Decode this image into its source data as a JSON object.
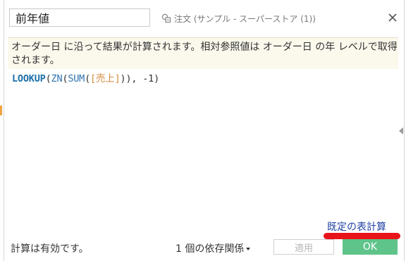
{
  "header": {
    "calc_name": "前年値",
    "datasource_label": "注文 (サンプル - スーパーストア (1))",
    "datasource_icon": "linked-datasource-icon",
    "close_icon": "close-icon"
  },
  "info": {
    "text": "オーダー日 に沿って結果が計算されます。相対参照値は オーダー日 の年 レベルで取得されます。"
  },
  "formula": {
    "func_lookup": "LOOKUP",
    "p1": "(",
    "func_zn": "ZN",
    "p2": "(",
    "func_sum": "SUM",
    "p3": "(",
    "field": "[売上]",
    "tail": ")), -1)"
  },
  "footer": {
    "default_table_calc": "既定の表計算",
    "status": "計算は有効です。",
    "dependencies": "1 個の依存関係",
    "apply": "適用",
    "ok": "OK"
  },
  "colors": {
    "ok_button": "#5fc48a",
    "annotation_mark": "#e8141c",
    "link": "#1f3fa3",
    "field": "#d58a3c",
    "keyword": "#1d6fa8"
  }
}
